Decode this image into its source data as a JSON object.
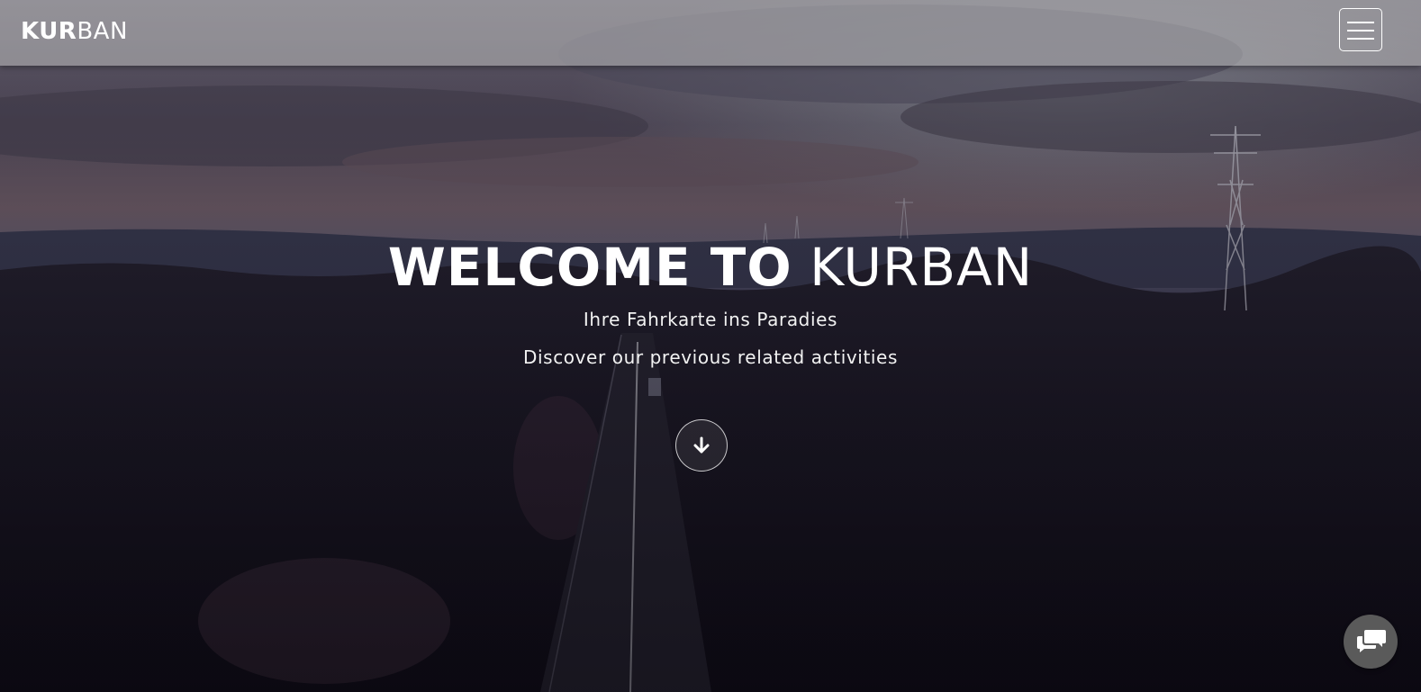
{
  "navbar": {
    "brand_bold": "KUR",
    "brand_light": "BAN",
    "menu_icon": "hamburger-menu-icon"
  },
  "hero": {
    "title_bold": "WELCOME TO",
    "title_light": "KURBAN",
    "subtitle_1": "Ihre Fahrkarte ins Paradies",
    "subtitle_2": "Discover our previous related activities",
    "scroll_icon": "arrow-down-icon"
  },
  "chat": {
    "icon": "chat-bubbles-icon"
  },
  "colors": {
    "navbar_bg": "#bebebe",
    "text": "#ffffff",
    "chat_bg": "#5a5a5a"
  }
}
